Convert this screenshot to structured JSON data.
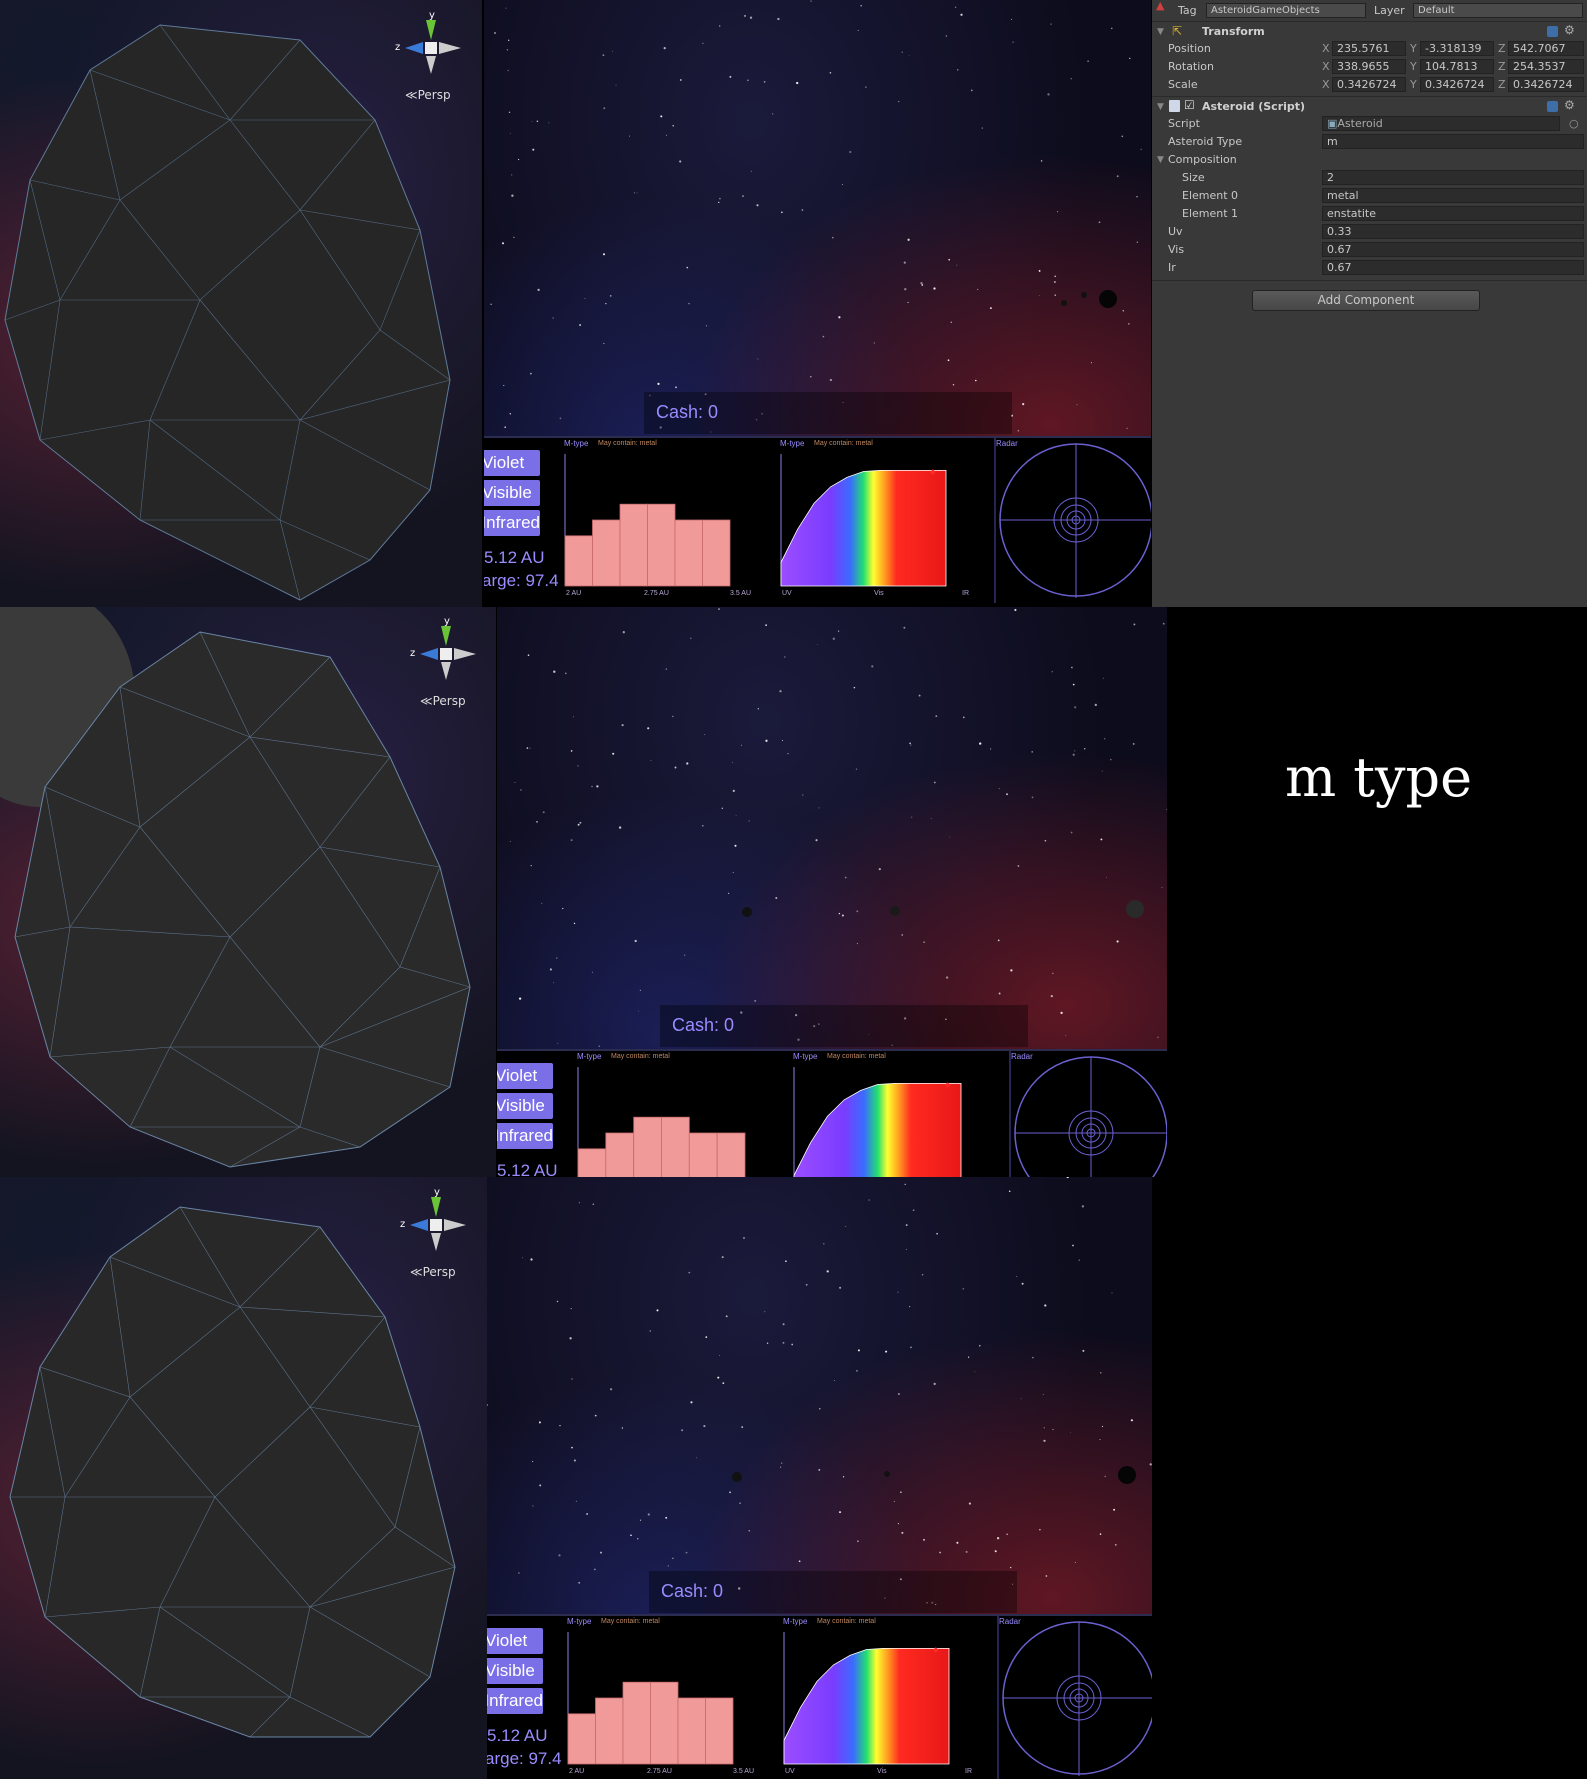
{
  "caption": "m type",
  "scene": {
    "gizmo_y": "y",
    "gizmo_z": "z",
    "persp_label": "Persp"
  },
  "game": {
    "cash_text": "Cash: 0",
    "buttons": [
      "Violet",
      "Visible",
      "Infrared"
    ],
    "distance_text": "5.12 AU",
    "charge_text": "arge: 97.4",
    "panel1": {
      "title": "M-type",
      "subtitle": "May contain: metal",
      "ticks": [
        "2 AU",
        "2.75 AU",
        "3.5 AU"
      ]
    },
    "panel2": {
      "title": "M-type",
      "subtitle": "May contain: metal",
      "ticks": [
        "UV",
        "Vis",
        "IR"
      ]
    },
    "panel3": {
      "title": "Radar"
    }
  },
  "chart_data": [
    {
      "type": "bar",
      "title": "M-type",
      "subtitle": "May contain: metal",
      "x": [
        2.0,
        2.25,
        2.5,
        2.75,
        3.0,
        3.25
      ],
      "values": [
        0.38,
        0.5,
        0.62,
        0.62,
        0.5,
        0.5
      ],
      "tick_labels": [
        "2 AU",
        "2.75 AU",
        "3.5 AU"
      ],
      "xlim": [
        2.0,
        3.5
      ],
      "ylim": [
        0,
        1
      ],
      "bar_color": "#f09a9a"
    },
    {
      "type": "area",
      "title": "M-type",
      "subtitle": "May contain: metal",
      "x": [
        0,
        0.1,
        0.2,
        0.3,
        0.4,
        0.5,
        0.6,
        0.7,
        0.8,
        0.9,
        1.0
      ],
      "y": [
        0.2,
        0.48,
        0.7,
        0.84,
        0.92,
        0.97,
        0.98,
        0.98,
        0.98,
        0.98,
        0.98
      ],
      "tick_labels": [
        "UV",
        "Vis",
        "IR"
      ],
      "marker": {
        "x": 0.92,
        "y": 0.78,
        "color": "#ff2a2a"
      },
      "ylim": [
        0,
        1.0
      ]
    }
  ],
  "inspector": {
    "tag_label": "Tag",
    "tag_value": "AsteroidGameObjects",
    "layer_label": "Layer",
    "layer_value": "Default",
    "transform": {
      "title": "Transform",
      "rows": [
        {
          "label": "Position",
          "x": "235.5761",
          "y": "-3.318139",
          "z": "542.7067"
        },
        {
          "label": "Rotation",
          "x": "338.9655",
          "y": "104.7813",
          "z": "254.3537"
        },
        {
          "label": "Scale",
          "x": "0.3426724",
          "y": "0.3426724",
          "z": "0.3426724"
        }
      ]
    },
    "asteroid_script": {
      "title": "Asteroid (Script)",
      "script_label": "Script",
      "script_value": "Asteroid",
      "type_label": "Asteroid Type",
      "type_value": "m",
      "composition_label": "Composition",
      "size_label": "Size",
      "size_value": "2",
      "element0_label": "Element 0",
      "element0_value": "metal",
      "element1_label": "Element 1",
      "element1_value": "enstatite",
      "uv_label": "Uv",
      "uv_value": "0.33",
      "vis_label": "Vis",
      "vis_value": "0.67",
      "ir_label": "Ir",
      "ir_value": "0.67"
    },
    "add_component": "Add Component"
  },
  "colors": {
    "hud_text": "#9a8cff",
    "button_bg": "#7a6fe6",
    "bar_fill": "#f09a9a",
    "inspector_bg": "#393939"
  }
}
